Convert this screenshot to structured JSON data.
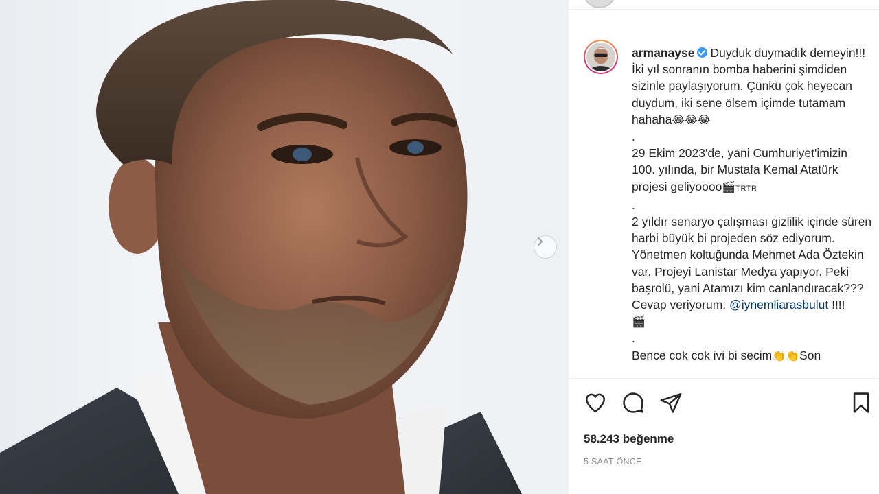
{
  "post": {
    "username": "armanayse",
    "caption": {
      "p1": "Duyduk duymadık demeyin!!! İki yıl sonranın bomba haberini şimdiden sizinle paylaşıyorum. Çünkü çok heyecan duydum, iki sene ölsem içimde tutamam hahaha",
      "p1_emoji": "😂😂😂",
      "dot1": ".",
      "p2": "29 Ekim 2023'de, yani Cumhuriyet'imizin 100. yılında, bir Mustafa Kemal Atatürk projesi geliyoooo",
      "p2_trtr": "TRTR",
      "dot2": ".",
      "p3": "2 yıldır senaryo çalışması gizlilik içinde süren harbi büyük bi projeden söz ediyorum. Yönetmen koltuğunda Mehmet Ada Öztekin var. Projeyi Lanistar Medya yapıyor. Peki başrolü, yani Atamızı kim canlandıracak???",
      "p4_prefix": "Cevap veriyorum: ",
      "mention": "@iynemliarasbulut",
      "p4_suffix": " !!!!",
      "dot3": ".",
      "p5": "Bence cok cok ivi bi secim",
      "p5_emoji": "👏👏",
      "p5_suffix": "Son"
    },
    "likes": "58.243 beğenme",
    "time": "5 SAAT ÖNCE"
  },
  "icons": {
    "like": "heart-icon",
    "comment": "comment-icon",
    "share": "share-icon",
    "save": "bookmark-icon",
    "next": "chevron-right-icon",
    "verified": "verified-badge-icon"
  },
  "colors": {
    "text": "#262626",
    "muted": "#8e8e8e",
    "link": "#00376b",
    "verified": "#3897f0",
    "border": "#efefef"
  }
}
